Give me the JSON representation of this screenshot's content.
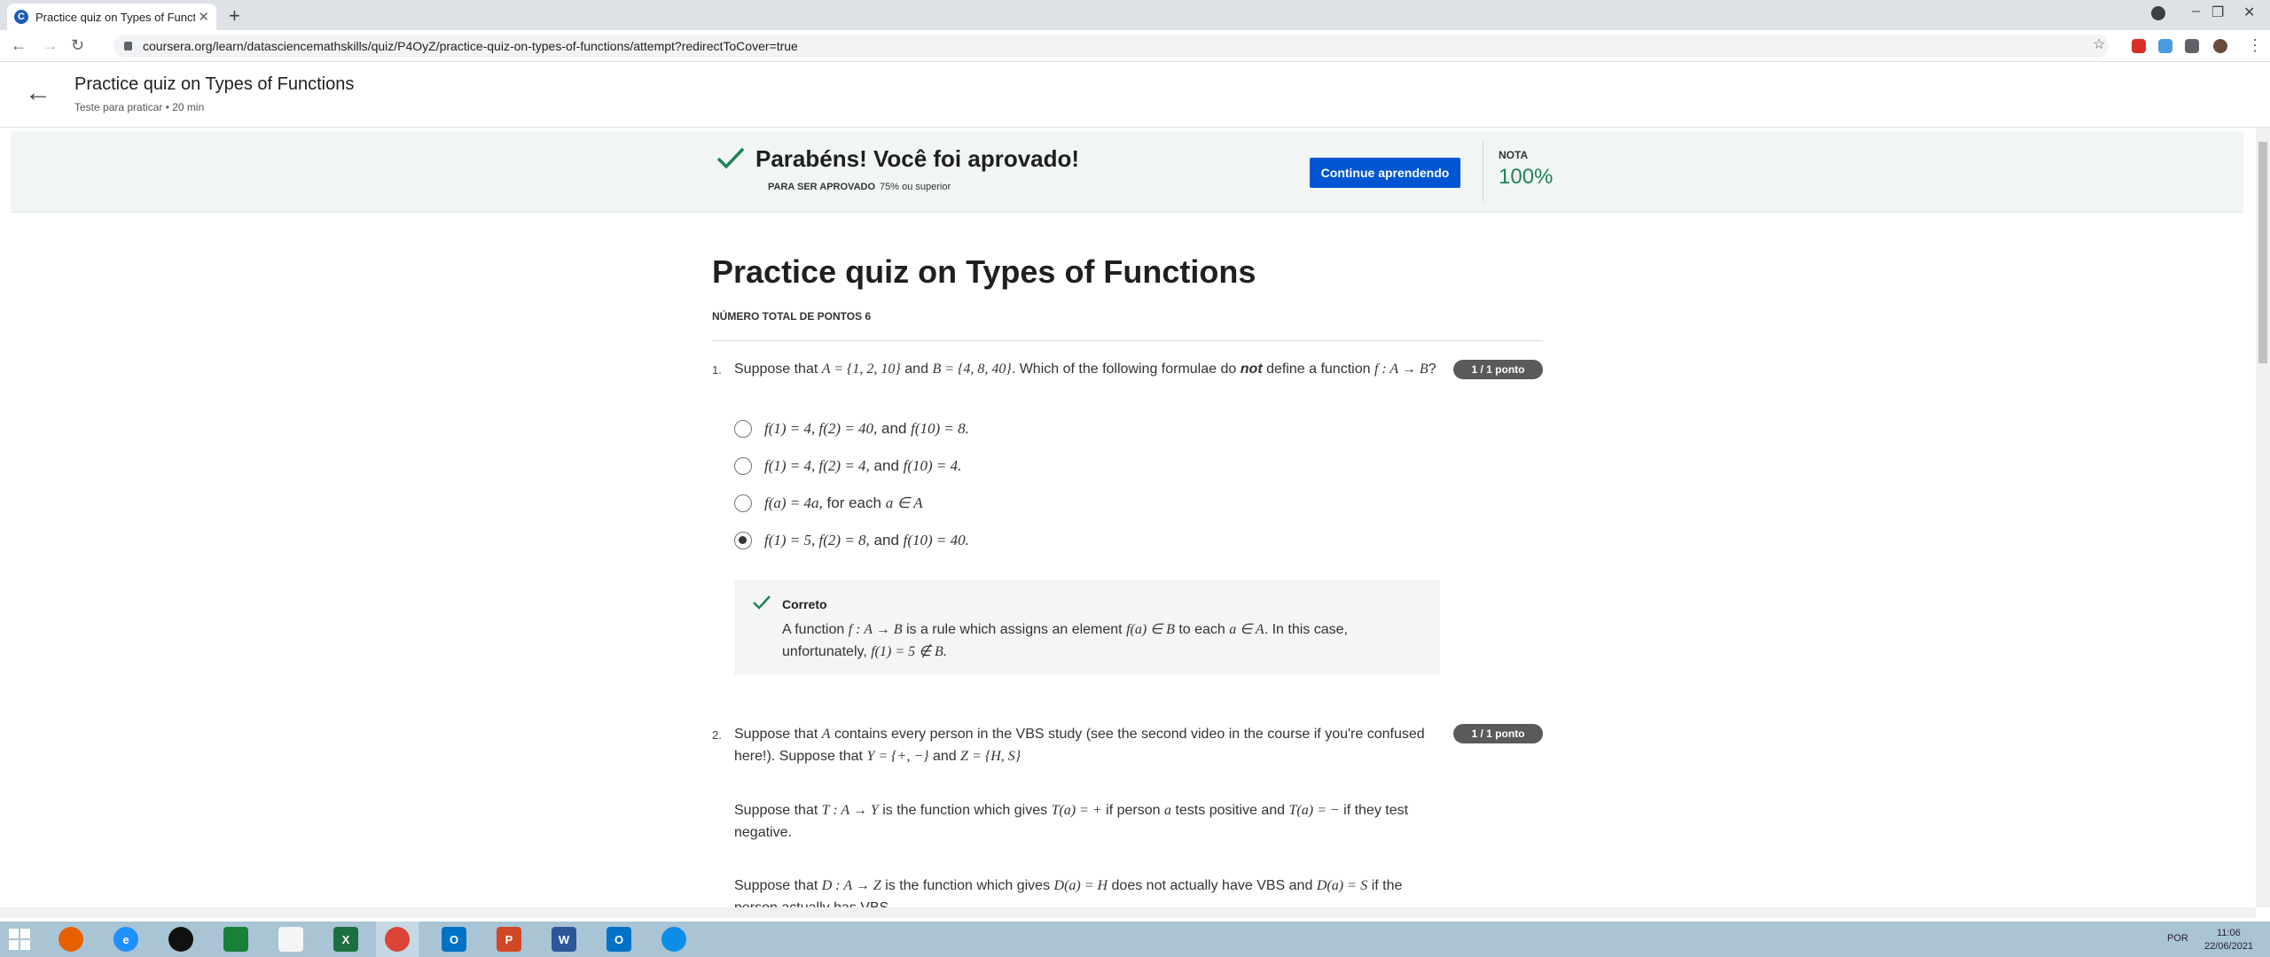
{
  "browser": {
    "tab_title": "Practice quiz on Types of Functions",
    "url": "coursera.org/learn/datasciencemathskills/quiz/P4OyZ/practice-quiz-on-types-of-functions/attempt?redirectToCover=true"
  },
  "header": {
    "title": "Practice quiz on Types of Functions",
    "subtitle": "Teste para praticar • 20 min"
  },
  "banner": {
    "message": "Parabéns! Você foi aprovado!",
    "requirement_label": "PARA SER APROVADO",
    "requirement_value": "75% ou superior",
    "button_label": "Continue aprendendo",
    "grade_label": "NOTA",
    "grade_value": "100%",
    "accent_color": "#1f8354",
    "button_color": "#0056d2"
  },
  "quiz": {
    "title": "Practice quiz on Types of Functions",
    "total_points": "NÚMERO TOTAL DE PONTOS 6",
    "questions": [
      {
        "number": "1.",
        "score": "1 / 1 ponto",
        "text_a": "Suppose that",
        "math_a": "A = {1, 2, 10}",
        "text_b": "and",
        "math_b": "B = {4, 8, 40}",
        "text_c": ". Which of the following formulae do",
        "keyword": "not",
        "text_d": "define a function",
        "math_c": "f : A → B",
        "text_e": "?",
        "options": [
          {
            "math_1": "f(1) = 4, f(2) = 40,",
            "sep": "and",
            "math_2": "f(10) = 8.",
            "selected": false
          },
          {
            "math_1": "f(1) = 4, f(2) = 4,",
            "sep": "and",
            "math_2": "f(10) = 4.",
            "selected": false
          },
          {
            "math_1": "f(a) = 4a,",
            "sep": "for each",
            "math_2": "a ∈ A",
            "selected": false
          },
          {
            "math_1": "f(1) = 5, f(2) = 8,",
            "sep": "and",
            "math_2": "f(10) = 40.",
            "selected": true
          }
        ],
        "feedback": {
          "label": "Correto",
          "t1": "A function",
          "m1": "f : A → B",
          "t2": "is a rule which assigns an element",
          "m2": "f(a) ∈ B",
          "t3": "to each",
          "m3": "a ∈ A",
          "t4": ". In this case, unfortunately,",
          "m4": "f(1) = 5 ∉ B."
        }
      },
      {
        "number": "2.",
        "score": "1 / 1 ponto",
        "p1_t1": "Suppose that",
        "p1_m1": "A",
        "p1_t2": "contains every person in the VBS study (see the second video in the course if you're confused here!). Suppose that",
        "p1_m2": "Y = {+, −}",
        "p1_t3": "and",
        "p1_m3": "Z = {H, S}",
        "p2_t1": "Suppose that",
        "p2_m1": "T : A → Y",
        "p2_t2": "is the function which gives",
        "p2_m2": "T(a) = +",
        "p2_t3": "if person",
        "p2_m3": "a",
        "p2_t4": "tests positive and",
        "p2_m4": "T(a) = −",
        "p2_t5": "if they test negative.",
        "p3_t1": "Suppose that",
        "p3_m1": "D : A → Z",
        "p3_t2": "is the function which gives",
        "p3_m2": "D(a) = H",
        "p3_t3": "does not actually have VBS and",
        "p3_m3": "D(a) =",
        "p3_m4": "S",
        "p3_t4": "if the person actually has VBS"
      }
    ]
  },
  "taskbar": {
    "time": "11:06",
    "date": "22/06/2021",
    "lang": "POR"
  }
}
